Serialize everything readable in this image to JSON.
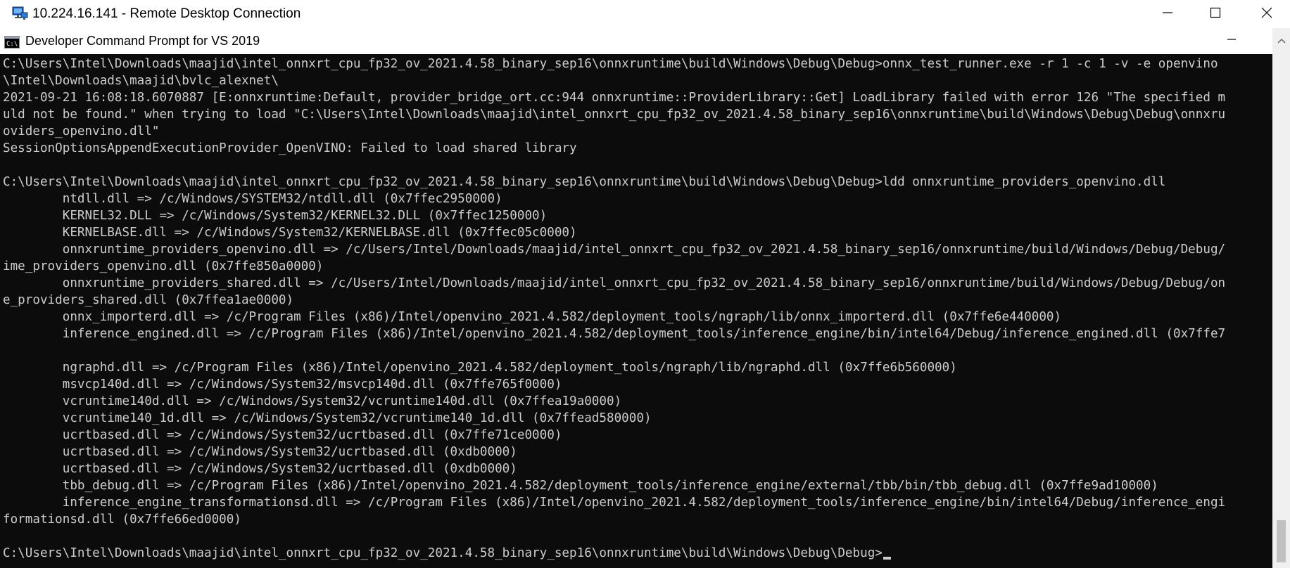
{
  "rdp_window": {
    "title": "10.224.16.141 - Remote Desktop Connection",
    "icon": "remote-desktop-icon",
    "controls": [
      "minimize-icon",
      "maximize-icon",
      "close-icon"
    ]
  },
  "cmd_window": {
    "title": "Developer Command Prompt for VS 2019",
    "icon": "cmd-icon",
    "controls": [
      "minimize-icon"
    ]
  },
  "console": {
    "lines": [
      "C:\\Users\\Intel\\Downloads\\maajid\\intel_onnxrt_cpu_fp32_ov_2021.4.58_binary_sep16\\onnxruntime\\build\\Windows\\Debug\\Debug>onnx_test_runner.exe -r 1 -c 1 -v -e openvino",
      "\\Intel\\Downloads\\maajid\\bvlc_alexnet\\",
      "2021-09-21 16:08:18.6070887 [E:onnxruntime:Default, provider_bridge_ort.cc:944 onnxruntime::ProviderLibrary::Get] LoadLibrary failed with error 126 \"The specified m",
      "uld not be found.\" when trying to load \"C:\\Users\\Intel\\Downloads\\maajid\\intel_onnxrt_cpu_fp32_ov_2021.4.58_binary_sep16\\onnxruntime\\build\\Windows\\Debug\\Debug\\onnxru",
      "oviders_openvino.dll\"",
      "SessionOptionsAppendExecutionProvider_OpenVINO: Failed to load shared library",
      "",
      "C:\\Users\\Intel\\Downloads\\maajid\\intel_onnxrt_cpu_fp32_ov_2021.4.58_binary_sep16\\onnxruntime\\build\\Windows\\Debug\\Debug>ldd onnxruntime_providers_openvino.dll",
      "        ntdll.dll => /c/Windows/SYSTEM32/ntdll.dll (0x7ffec2950000)",
      "        KERNEL32.DLL => /c/Windows/System32/KERNEL32.DLL (0x7ffec1250000)",
      "        KERNELBASE.dll => /c/Windows/System32/KERNELBASE.dll (0x7ffec05c0000)",
      "        onnxruntime_providers_openvino.dll => /c/Users/Intel/Downloads/maajid/intel_onnxrt_cpu_fp32_ov_2021.4.58_binary_sep16/onnxruntime/build/Windows/Debug/Debug/",
      "ime_providers_openvino.dll (0x7ffe850a0000)",
      "        onnxruntime_providers_shared.dll => /c/Users/Intel/Downloads/maajid/intel_onnxrt_cpu_fp32_ov_2021.4.58_binary_sep16/onnxruntime/build/Windows/Debug/Debug/on",
      "e_providers_shared.dll (0x7ffea1ae0000)",
      "        onnx_importerd.dll => /c/Program Files (x86)/Intel/openvino_2021.4.582/deployment_tools/ngraph/lib/onnx_importerd.dll (0x7ffe6e440000)",
      "        inference_engined.dll => /c/Program Files (x86)/Intel/openvino_2021.4.582/deployment_tools/inference_engine/bin/intel64/Debug/inference_engined.dll (0x7ffe7",
      "",
      "        ngraphd.dll => /c/Program Files (x86)/Intel/openvino_2021.4.582/deployment_tools/ngraph/lib/ngraphd.dll (0x7ffe6b560000)",
      "        msvcp140d.dll => /c/Windows/System32/msvcp140d.dll (0x7ffe765f0000)",
      "        vcruntime140d.dll => /c/Windows/System32/vcruntime140d.dll (0x7ffea19a0000)",
      "        vcruntime140_1d.dll => /c/Windows/System32/vcruntime140_1d.dll (0x7ffead580000)",
      "        ucrtbased.dll => /c/Windows/System32/ucrtbased.dll (0x7ffe71ce0000)",
      "        ucrtbased.dll => /c/Windows/System32/ucrtbased.dll (0xdb0000)",
      "        ucrtbased.dll => /c/Windows/System32/ucrtbased.dll (0xdb0000)",
      "        tbb_debug.dll => /c/Program Files (x86)/Intel/openvino_2021.4.582/deployment_tools/inference_engine/external/tbb/bin/tbb_debug.dll (0x7ffe9ad10000)",
      "        inference_engine_transformationsd.dll => /c/Program Files (x86)/Intel/openvino_2021.4.582/deployment_tools/inference_engine/bin/intel64/Debug/inference_engi",
      "formationsd.dll (0x7ffe66ed0000)",
      ""
    ],
    "prompt": "C:\\Users\\Intel\\Downloads\\maajid\\intel_onnxrt_cpu_fp32_ov_2021.4.58_binary_sep16\\onnxruntime\\build\\Windows\\Debug\\Debug>"
  },
  "colors": {
    "console_bg": "#0c0c0c",
    "console_fg": "#cccccc",
    "title_bg": "#ffffff"
  }
}
